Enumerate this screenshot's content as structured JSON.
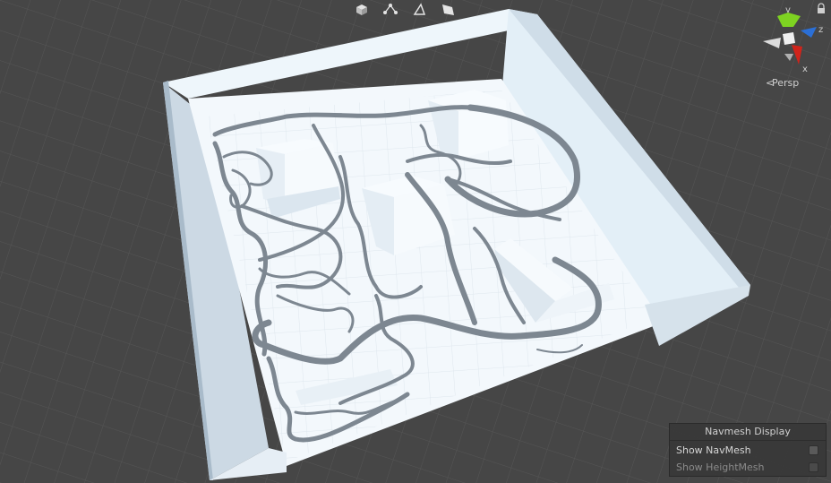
{
  "toolbar": {
    "icons": [
      "cube-icon",
      "graph-icon",
      "triangle-icon",
      "flag-icon"
    ]
  },
  "gizmo": {
    "axis_y": "y",
    "axis_z": "z",
    "axis_x": "x",
    "projection": "Persp",
    "colors": {
      "y": "#7ed321",
      "z": "#2b6fd6",
      "x": "#d0241b"
    }
  },
  "navmesh_panel": {
    "title": "Navmesh Display",
    "show_navmesh": {
      "label": "Show NavMesh",
      "checked": false
    },
    "show_heightmesh": {
      "label": "Show HeightMesh",
      "checked": false
    }
  },
  "scene_colors": {
    "background": "#464646",
    "walls": "#e3f1fa",
    "floor": "#f2f8fd",
    "paths": "#7d8791"
  }
}
